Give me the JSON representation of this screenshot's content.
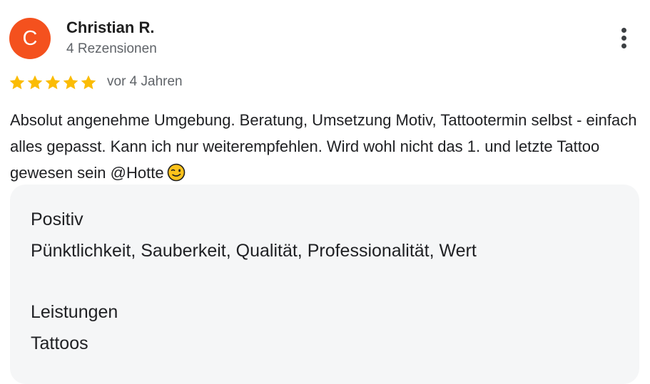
{
  "reviewer": {
    "avatar_initial": "C",
    "name": "Christian R.",
    "meta": "4 Rezensionen"
  },
  "rating": {
    "stars": 5,
    "max": 5,
    "star_color": "#fbbc04"
  },
  "review": {
    "date": "vor 4 Jahren",
    "text": "Absolut angenehme Umgebung. Beratung, Umsetzung Motiv, Tattootermin selbst - einfach alles gepasst. Kann ich nur weiterempfehlen. Wird wohl nicht das 1. und letzte Tattoo gewesen sein @Hotte",
    "emoji": "winking-face"
  },
  "attributes": {
    "positive_label": "Positiv",
    "positive_value": "Pünktlichkeit, Sauberkeit, Qualität, Professionalität, Wert",
    "services_label": "Leistungen",
    "services_value": "Tattoos"
  },
  "icons": {
    "more": "more-vert-icon",
    "star": "star-icon"
  },
  "colors": {
    "avatar_bg": "#f4511e",
    "box_bg": "#f5f6f7"
  }
}
